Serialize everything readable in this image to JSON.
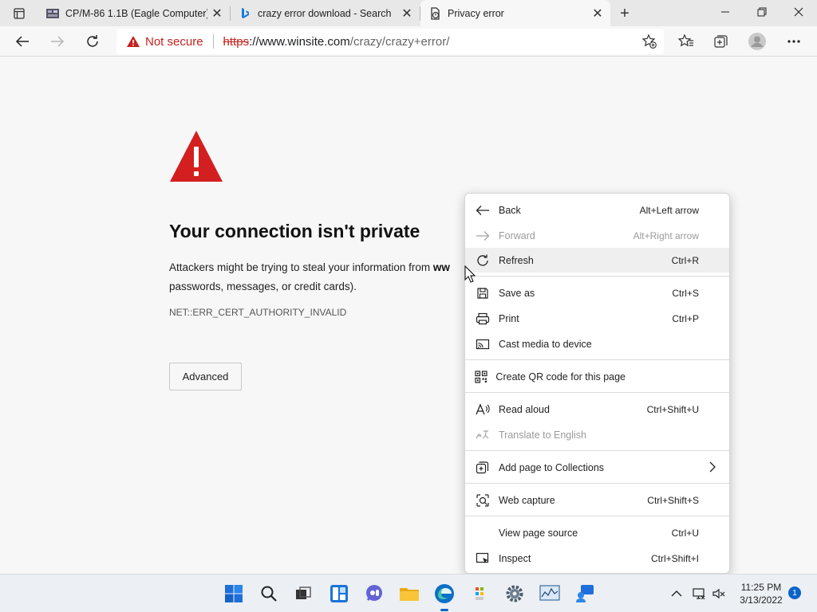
{
  "browser": {
    "tabs": [
      {
        "title": "CP/M-86 1.1B (Eagle Computer)",
        "active": false
      },
      {
        "title": "crazy error download - Search",
        "active": false
      },
      {
        "title": "Privacy error",
        "active": true
      }
    ],
    "close_glyph": "✕",
    "new_tab_glyph": "+",
    "omnibox": {
      "warning": "Not secure",
      "url_scheme": "https",
      "url_host": "://www.winsite.com",
      "url_path": "/crazy/crazy+error/"
    }
  },
  "page": {
    "headline": "Your connection isn't private",
    "description_line1": "Attackers might be trying to steal your information from ",
    "description_bold": "ww",
    "description_line2": "passwords, messages, or credit cards).",
    "error_code": "NET::ERR_CERT_AUTHORITY_INVALID",
    "advanced_button": "Advanced"
  },
  "context_menu": {
    "items": [
      {
        "label": "Back",
        "shortcut": "Alt+Left arrow",
        "icon": "back-arrow-icon",
        "disabled": false
      },
      {
        "label": "Forward",
        "shortcut": "Alt+Right arrow",
        "icon": "forward-arrow-icon",
        "disabled": true
      },
      {
        "label": "Refresh",
        "shortcut": "Ctrl+R",
        "icon": "refresh-icon",
        "disabled": false,
        "hover": true
      },
      {
        "label": "Save as",
        "shortcut": "Ctrl+S",
        "icon": "save-icon",
        "disabled": false
      },
      {
        "label": "Print",
        "shortcut": "Ctrl+P",
        "icon": "printer-icon",
        "disabled": false
      },
      {
        "label": "Cast media to device",
        "shortcut": "",
        "icon": "cast-icon",
        "disabled": false
      },
      {
        "label": "Create QR code for this page",
        "shortcut": "",
        "icon": "qr-code-icon",
        "disabled": false
      },
      {
        "label": "Read aloud",
        "shortcut": "Ctrl+Shift+U",
        "icon": "read-aloud-icon",
        "disabled": false
      },
      {
        "label": "Translate to English",
        "shortcut": "",
        "icon": "translate-icon",
        "disabled": true
      },
      {
        "label": "Add page to Collections",
        "shortcut": "",
        "icon": "collections-icon",
        "disabled": false,
        "submenu": true
      },
      {
        "label": "Web capture",
        "shortcut": "Ctrl+Shift+S",
        "icon": "web-capture-icon",
        "disabled": false
      },
      {
        "label": "View page source",
        "shortcut": "Ctrl+U",
        "icon": "",
        "disabled": false
      },
      {
        "label": "Inspect",
        "shortcut": "Ctrl+Shift+I",
        "icon": "inspect-icon",
        "disabled": false
      }
    ]
  },
  "taskbar": {
    "clock_time": "11:25 PM",
    "clock_date": "3/13/2022",
    "notification_count": "1"
  },
  "colors": {
    "warning_red": "#c5221f",
    "error_triangle": "#d31f1f",
    "accent_blue": "#0a64c8"
  }
}
